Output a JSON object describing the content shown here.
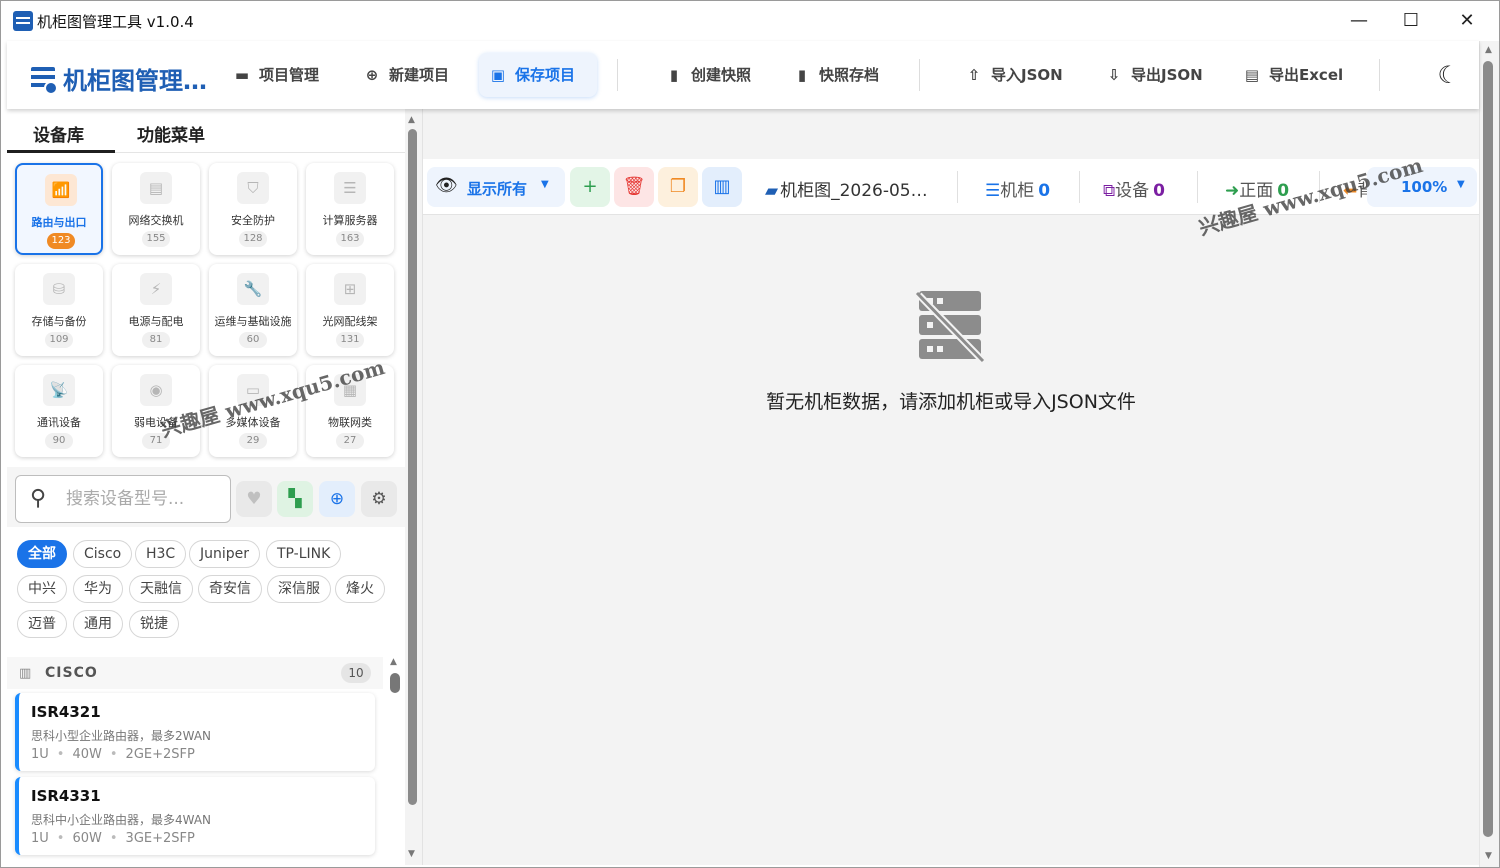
{
  "window": {
    "title": "机柜图管理工具 v1.0.4",
    "minimize_glyph": "—",
    "maximize_glyph": "☐",
    "close_glyph": "✕"
  },
  "toolbar": {
    "logo_text": "机柜图管理…",
    "buttons": {
      "project_manage": "项目管理",
      "new_project": "新建项目",
      "save_project": "保存项目",
      "create_snapshot": "创建快照",
      "snapshot_archive": "快照存档",
      "import_json": "导入JSON",
      "export_json": "导出JSON",
      "export_excel": "导出Excel"
    },
    "icons": {
      "project_manage": "folder-icon",
      "new_project": "plus-circle-icon",
      "save_project": "save-icon",
      "create_snapshot": "bookmark-icon",
      "snapshot_archive": "bookmark-icon",
      "import_json": "upload-icon",
      "export_json": "download-icon",
      "export_excel": "excel-file-icon",
      "theme": "moon-icon"
    }
  },
  "left_panel": {
    "tabs": [
      "设备库",
      "功能菜单"
    ],
    "categories": [
      {
        "label": "路由与出口",
        "count": "123",
        "icon": "router-icon"
      },
      {
        "label": "网络交换机",
        "count": "155",
        "icon": "switch-icon"
      },
      {
        "label": "安全防护",
        "count": "128",
        "icon": "shield-icon"
      },
      {
        "label": "计算服务器",
        "count": "163",
        "icon": "server-icon"
      },
      {
        "label": "存储与备份",
        "count": "109",
        "icon": "database-icon"
      },
      {
        "label": "电源与配电",
        "count": "81",
        "icon": "plug-icon"
      },
      {
        "label": "运维与基础设施",
        "count": "60",
        "icon": "wrench-icon"
      },
      {
        "label": "光网配线架",
        "count": "131",
        "icon": "network-icon"
      },
      {
        "label": "通讯设备",
        "count": "90",
        "icon": "antenna-icon"
      },
      {
        "label": "弱电设备",
        "count": "71",
        "icon": "broadcast-icon"
      },
      {
        "label": "多媒体设备",
        "count": "29",
        "icon": "projector-icon"
      },
      {
        "label": "物联网类",
        "count": "27",
        "icon": "chip-icon"
      }
    ],
    "search": {
      "placeholder": "搜索设备型号..."
    },
    "brands": [
      "全部",
      "Cisco",
      "H3C",
      "Juniper",
      "TP-LINK",
      "中兴",
      "华为",
      "天融信",
      "奇安信",
      "深信服",
      "烽火",
      "迈普",
      "通用",
      "锐捷"
    ],
    "group": {
      "name": "CISCO",
      "count": "10"
    },
    "devices": [
      {
        "name": "ISR4321",
        "desc": "思科小型企业路由器，最多2WAN",
        "u": "1U",
        "power": "40W",
        "ports": "2GE+2SFP"
      },
      {
        "name": "ISR4331",
        "desc": "思科中小企业路由器，最多4WAN",
        "u": "1U",
        "power": "60W",
        "ports": "3GE+2SFP"
      }
    ]
  },
  "main": {
    "view_label": "显示所有",
    "project_name": "机柜图_2026-05…",
    "stats": {
      "cabinet_label": "机柜",
      "cabinet_count": "0",
      "device_label": "设备",
      "device_count": "0",
      "front_label": "正面",
      "front_count": "0",
      "back_label": "背面"
    },
    "zoom": "100%",
    "empty_message": "暂无机柜数据，请添加机柜或导入JSON文件"
  },
  "watermarks": [
    "兴趣屋 www.xqu5.com",
    "兴趣屋 www.xqu5.com"
  ],
  "colors": {
    "accent": "#1a73e8",
    "brand_blue": "#1f5fb4",
    "orange": "#f08a24",
    "green": "#2e9e4f",
    "red": "#e53935",
    "purple": "#7b1fa2"
  }
}
